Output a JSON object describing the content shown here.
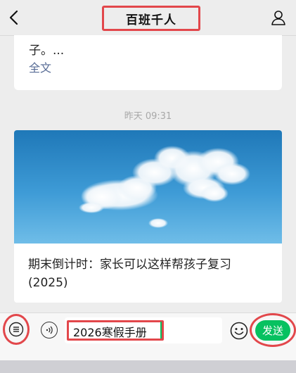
{
  "header": {
    "title": "百班千人",
    "back_icon": "back-icon",
    "profile_icon": "user-icon"
  },
  "messages": [
    {
      "text_snippet": "子。...",
      "link_label": "全文"
    }
  ],
  "timestamp": "昨天 09:31",
  "article": {
    "image_icon": "sky-clouds-image",
    "title": "期末倒计时：家长可以这样帮孩子复习(2025)"
  },
  "inputbar": {
    "menu_icon": "list-menu-icon",
    "voice_icon": "voice-icon",
    "input_value": "2026寒假手册",
    "emoji_icon": "emoji-icon",
    "send_label": "发送"
  },
  "colors": {
    "accent_green": "#07c160",
    "highlight_red": "#e2474b",
    "link_blue": "#576b95"
  }
}
